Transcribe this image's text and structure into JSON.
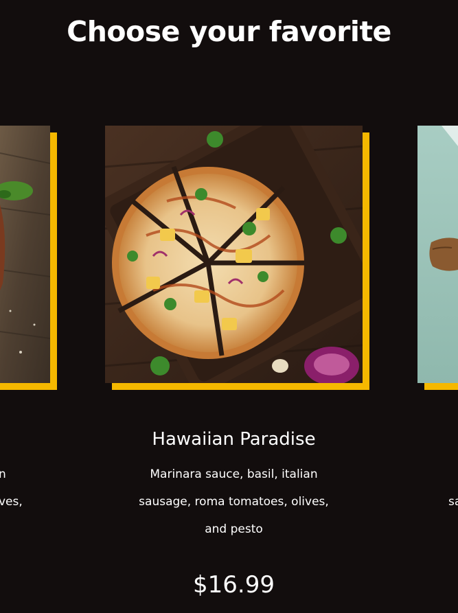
{
  "section": {
    "title": "Choose your favorite"
  },
  "cards": [
    {
      "name": "",
      "description_lines": [
        "n",
        "ves,"
      ],
      "price": ""
    },
    {
      "name": "Hawaiian Paradise",
      "description_lines": [
        "Marinara sauce, basil, italian",
        "sausage, roma tomatoes, olives,",
        "and pesto"
      ],
      "price": "$16.99"
    },
    {
      "name": "",
      "description_lines": [
        "",
        "sa"
      ],
      "price": ""
    }
  ],
  "colors": {
    "background": "#120d0d",
    "accent": "#f5b800",
    "text": "#ffffff"
  },
  "images": {
    "left": "food-photo-icon",
    "center": "hawaiian-pizza-photo-icon",
    "right": "food-photo-icon"
  }
}
